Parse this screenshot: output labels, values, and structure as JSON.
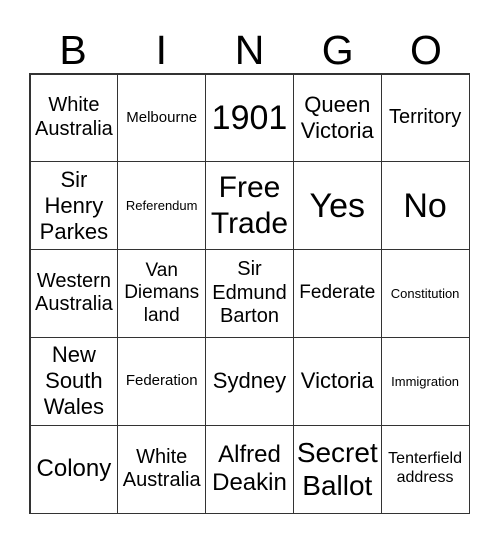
{
  "header": {
    "letters": [
      "B",
      "I",
      "N",
      "G",
      "O"
    ]
  },
  "cells": [
    "White Australia",
    "Melbourne",
    "1901",
    "Queen Victoria",
    "Territory",
    "Sir Henry Parkes",
    "Referendum",
    "Free Trade",
    "Yes",
    "No",
    "Western Australia",
    "Van Diemans land",
    "Sir Edmund Barton",
    "Federate",
    "Constitution",
    "New South Wales",
    "Federation",
    "Sydney",
    "Victoria",
    "Immigration",
    "Colony",
    "White Australia",
    "Alfred Deakin",
    "Secret Ballot",
    "Tenterfield address"
  ]
}
